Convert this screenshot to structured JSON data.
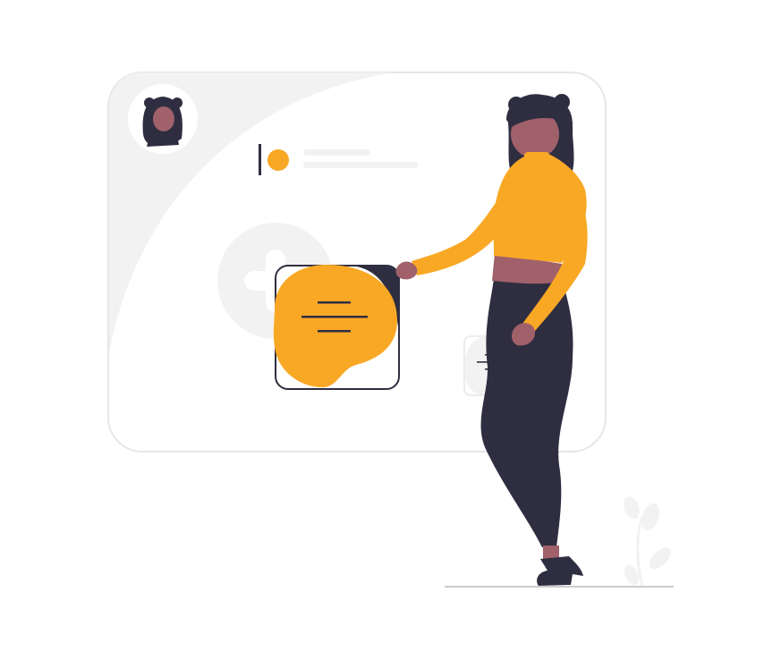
{
  "illustration": {
    "subject": "woman-holding-message-cards",
    "colors": {
      "accent": "#f9a825",
      "dark": "#2f2e41",
      "skin": "#a0616a",
      "panel": "#f2f2f2",
      "panel_border": "#e6e6e6",
      "line": "#cccccc",
      "white": "#ffffff"
    },
    "icons": [
      "avatar-icon",
      "plus-icon",
      "chat-bubble-icon",
      "plant-icon"
    ]
  }
}
